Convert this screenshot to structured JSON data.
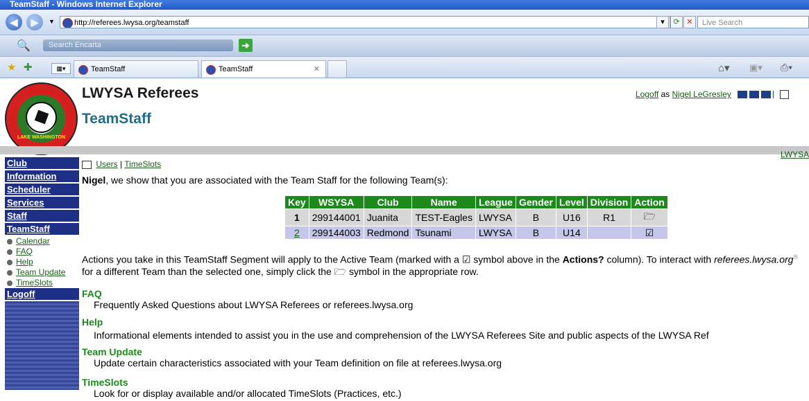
{
  "browser": {
    "window_title": "TeamStaff - Windows Internet Explorer",
    "url": "http://referees.lwysa.org/teamstaff",
    "search_placeholder": "Live Search",
    "encarta_placeholder": "Search Encarta",
    "tabs": [
      {
        "label": "TeamStaff"
      },
      {
        "label": "TeamStaff"
      }
    ]
  },
  "header": {
    "site_title": "LWYSA Referees",
    "page_title": "TeamStaff",
    "logoff_link": "Logoff",
    "as_text": " as ",
    "user_name": "Nigel LeGresley",
    "logo_text": "LAKE WASHINGTON YOUTH SOCCER",
    "band_link": "LWYSA"
  },
  "sidebar": {
    "items": [
      "Club",
      "Information",
      "Scheduler",
      "Services",
      "Staff",
      "TeamStaff"
    ],
    "sub_items": [
      "Calendar",
      "FAQ",
      "Help",
      "Team Update",
      "TimeSlots"
    ],
    "logoff": "Logoff"
  },
  "breadcrumb": {
    "users": "Users",
    "separator": " | ",
    "timeslots": "TimeSlots"
  },
  "intro": {
    "name": "Nigel",
    "text": ", we show that you are associated with the Team Staff for the following Team(s):"
  },
  "table": {
    "headers": [
      "Key",
      "WSYSA",
      "Club",
      "Name",
      "League",
      "Gender",
      "Level",
      "Division",
      "Action"
    ],
    "rows": [
      {
        "key": "1",
        "wsysa": "299144001",
        "club": "Juanita",
        "name": "TEST-Eagles",
        "league": "LWYSA",
        "gender": "B",
        "level": "U16",
        "division": "R1",
        "action": "🗁"
      },
      {
        "key": "2",
        "wsysa": "299144003",
        "club": "Redmond",
        "name": "Tsunami",
        "league": "LWYSA",
        "gender": "B",
        "level": "U14",
        "division": "",
        "action": "☑"
      }
    ]
  },
  "actions_text": {
    "p1": "Actions you take in this TeamStaff Segment will apply to the Active Team (marked with a ",
    "check": "☑",
    "p2": " symbol above in the ",
    "bold": "Actions?",
    "p3": " column). To interact with ",
    "site": "referees.lwysa.org",
    "reg": "®",
    "p4": " for a different Team than the selected one, simply click the ",
    "folder": "🗁",
    "p5": " symbol in the appropriate row."
  },
  "sections": [
    {
      "title": "FAQ",
      "desc": "Frequently Asked Questions about LWYSA Referees or referees.lwysa.org"
    },
    {
      "title": "Help",
      "desc": "Informational elements intended to assist you in the use and comprehension of the LWYSA Referees Site and public aspects of the LWYSA Ref"
    },
    {
      "title": "Team Update",
      "desc": "Update certain characteristics associated with your Team definition on file at referees.lwysa.org"
    },
    {
      "title": "TimeSlots",
      "desc": "Look for or display available and/or allocated TimeSlots (Practices, etc.)"
    }
  ]
}
